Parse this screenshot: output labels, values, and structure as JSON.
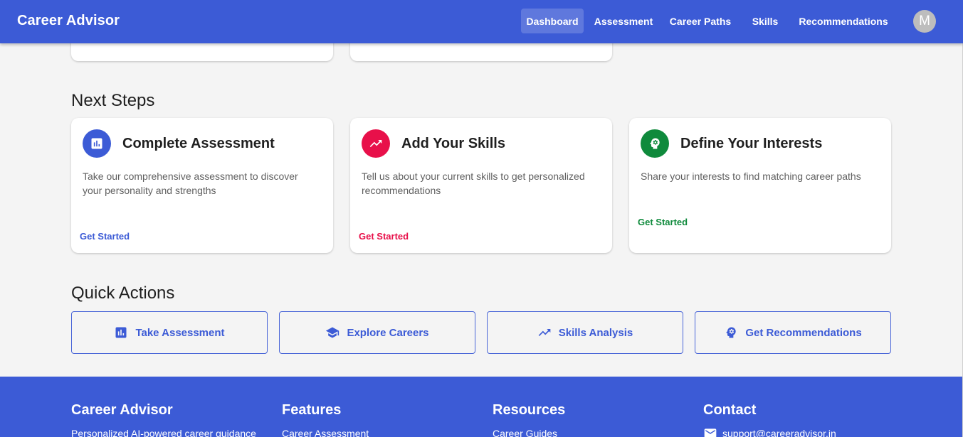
{
  "app": {
    "title": "Career Advisor"
  },
  "nav": {
    "items": [
      "Dashboard",
      "Assessment",
      "Career Paths",
      "Skills",
      "Recommendations"
    ],
    "active": "Dashboard",
    "avatar_initial": "M"
  },
  "next_steps": {
    "title": "Next Steps",
    "cards": [
      {
        "title": "Complete Assessment",
        "description": "Take our comprehensive assessment to discover your personality and strengths",
        "link": "Get Started",
        "color": "#3c5bd6",
        "icon": "assessment-icon"
      },
      {
        "title": "Add Your Skills",
        "description": "Tell us about your current skills to get personalized recommendations",
        "link": "Get Started",
        "color": "#e8104a",
        "icon": "trending-up-icon"
      },
      {
        "title": "Define Your Interests",
        "description": "Share your interests to find matching career paths",
        "link": "Get Started",
        "color": "#0f8a3c",
        "icon": "psychology-icon"
      }
    ]
  },
  "quick_actions": {
    "title": "Quick Actions",
    "buttons": [
      {
        "label": "Take Assessment",
        "icon": "assessment-icon"
      },
      {
        "label": "Explore Careers",
        "icon": "school-icon"
      },
      {
        "label": "Skills Analysis",
        "icon": "trending-up-icon"
      },
      {
        "label": "Get Recommendations",
        "icon": "psychology-icon"
      }
    ]
  },
  "footer": {
    "columns": [
      {
        "heading": "Career Advisor",
        "line": "Personalized AI-powered career guidance"
      },
      {
        "heading": "Features",
        "line": "Career Assessment"
      },
      {
        "heading": "Resources",
        "line": "Career Guides"
      },
      {
        "heading": "Contact",
        "line": "support@careeradvisor.in",
        "icon": "email-icon"
      }
    ]
  },
  "colors": {
    "primary": "#3c5bd6",
    "accent_red": "#e8104a",
    "accent_green": "#0f8a3c"
  }
}
